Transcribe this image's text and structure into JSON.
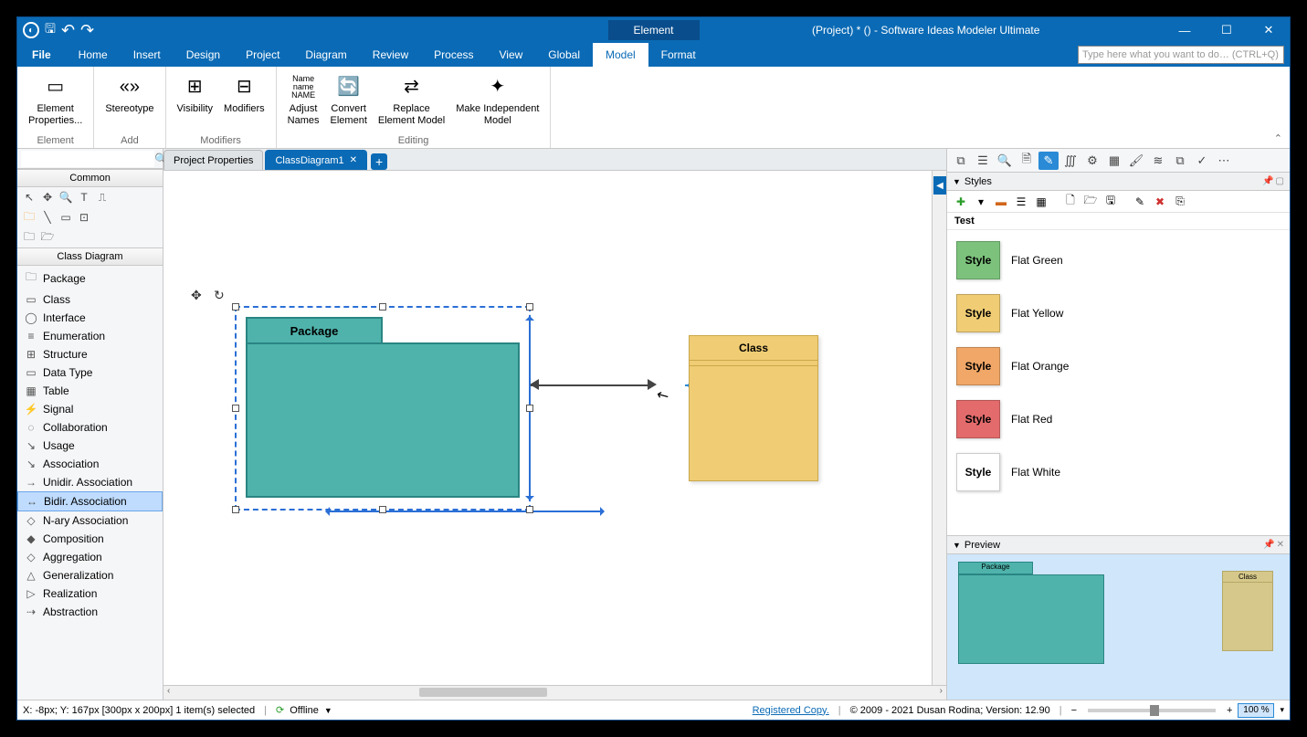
{
  "window": {
    "context_tab": "Element",
    "title": "(Project) *  ()  -  Software Ideas Modeler Ultimate"
  },
  "menu": {
    "file": "File",
    "items": [
      "Home",
      "Insert",
      "Design",
      "Project",
      "Diagram",
      "Review",
      "Process",
      "View",
      "Global",
      "Model",
      "Format"
    ],
    "active": "Model",
    "search_placeholder": "Type here what you want to do…  (CTRL+Q)"
  },
  "ribbon": {
    "groups": [
      {
        "label": "Element",
        "buttons": [
          "Element\nProperties..."
        ]
      },
      {
        "label": "Add",
        "buttons": [
          "Stereotype"
        ]
      },
      {
        "label": "Modifiers",
        "buttons": [
          "Visibility",
          "Modifiers"
        ]
      },
      {
        "label": "Editing",
        "buttons": [
          "Adjust\nNames",
          "Convert\nElement",
          "Replace\nElement Model",
          "Make Independent\nModel"
        ]
      }
    ]
  },
  "left": {
    "common": "Common",
    "class_diagram": "Class Diagram",
    "items": [
      "Package",
      "Class",
      "Interface",
      "Enumeration",
      "Structure",
      "Data Type",
      "Table",
      "Signal",
      "Collaboration",
      "Usage",
      "Association",
      "Unidir. Association",
      "Bidir. Association",
      "N-ary Association",
      "Composition",
      "Aggregation",
      "Generalization",
      "Realization",
      "Abstraction"
    ],
    "selected": "Bidir. Association"
  },
  "tabs": {
    "items": [
      "Project Properties",
      "ClassDiagram1"
    ],
    "active": "ClassDiagram1"
  },
  "canvas": {
    "package_label": "Package",
    "class_label": "Class"
  },
  "styles": {
    "title": "Styles",
    "subhead": "Test",
    "items": [
      {
        "swatch": "sw-green",
        "label": "Flat Green"
      },
      {
        "swatch": "sw-yellow",
        "label": "Flat Yellow"
      },
      {
        "swatch": "sw-orange",
        "label": "Flat Orange"
      },
      {
        "swatch": "sw-red",
        "label": "Flat Red"
      },
      {
        "swatch": "sw-white",
        "label": "Flat White"
      }
    ],
    "swatch_text": "Style"
  },
  "preview": {
    "title": "Preview",
    "package": "Package",
    "class": "Class"
  },
  "status": {
    "coords": "X: -8px; Y: 167px  [300px x 200px] 1 item(s) selected",
    "offline": "Offline",
    "registered": "Registered Copy.",
    "copyright": "© 2009 - 2021 Dusan Rodina; Version: 12.90",
    "zoom": "100 %"
  }
}
